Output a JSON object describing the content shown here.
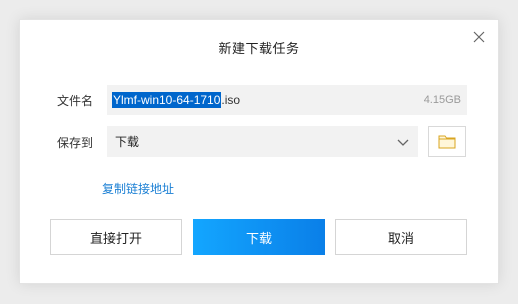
{
  "dialog": {
    "title": "新建下载任务",
    "close_icon": "close-icon"
  },
  "filename": {
    "label": "文件名",
    "value_selected": "Ylmf-win10-64-1710",
    "value_ext": ".iso",
    "size": "4.15GB"
  },
  "save_to": {
    "label": "保存到",
    "value": "下载",
    "dropdown_icon": "chevron-down-icon",
    "browse_icon": "folder-icon"
  },
  "copy_link": {
    "label": "复制链接地址"
  },
  "buttons": {
    "open_directly": "直接打开",
    "download": "下载",
    "cancel": "取消"
  },
  "colors": {
    "primary": "#0a88f0",
    "link": "#1a7fd4",
    "selection": "#0066cc",
    "field_bg": "#f2f2f2"
  }
}
